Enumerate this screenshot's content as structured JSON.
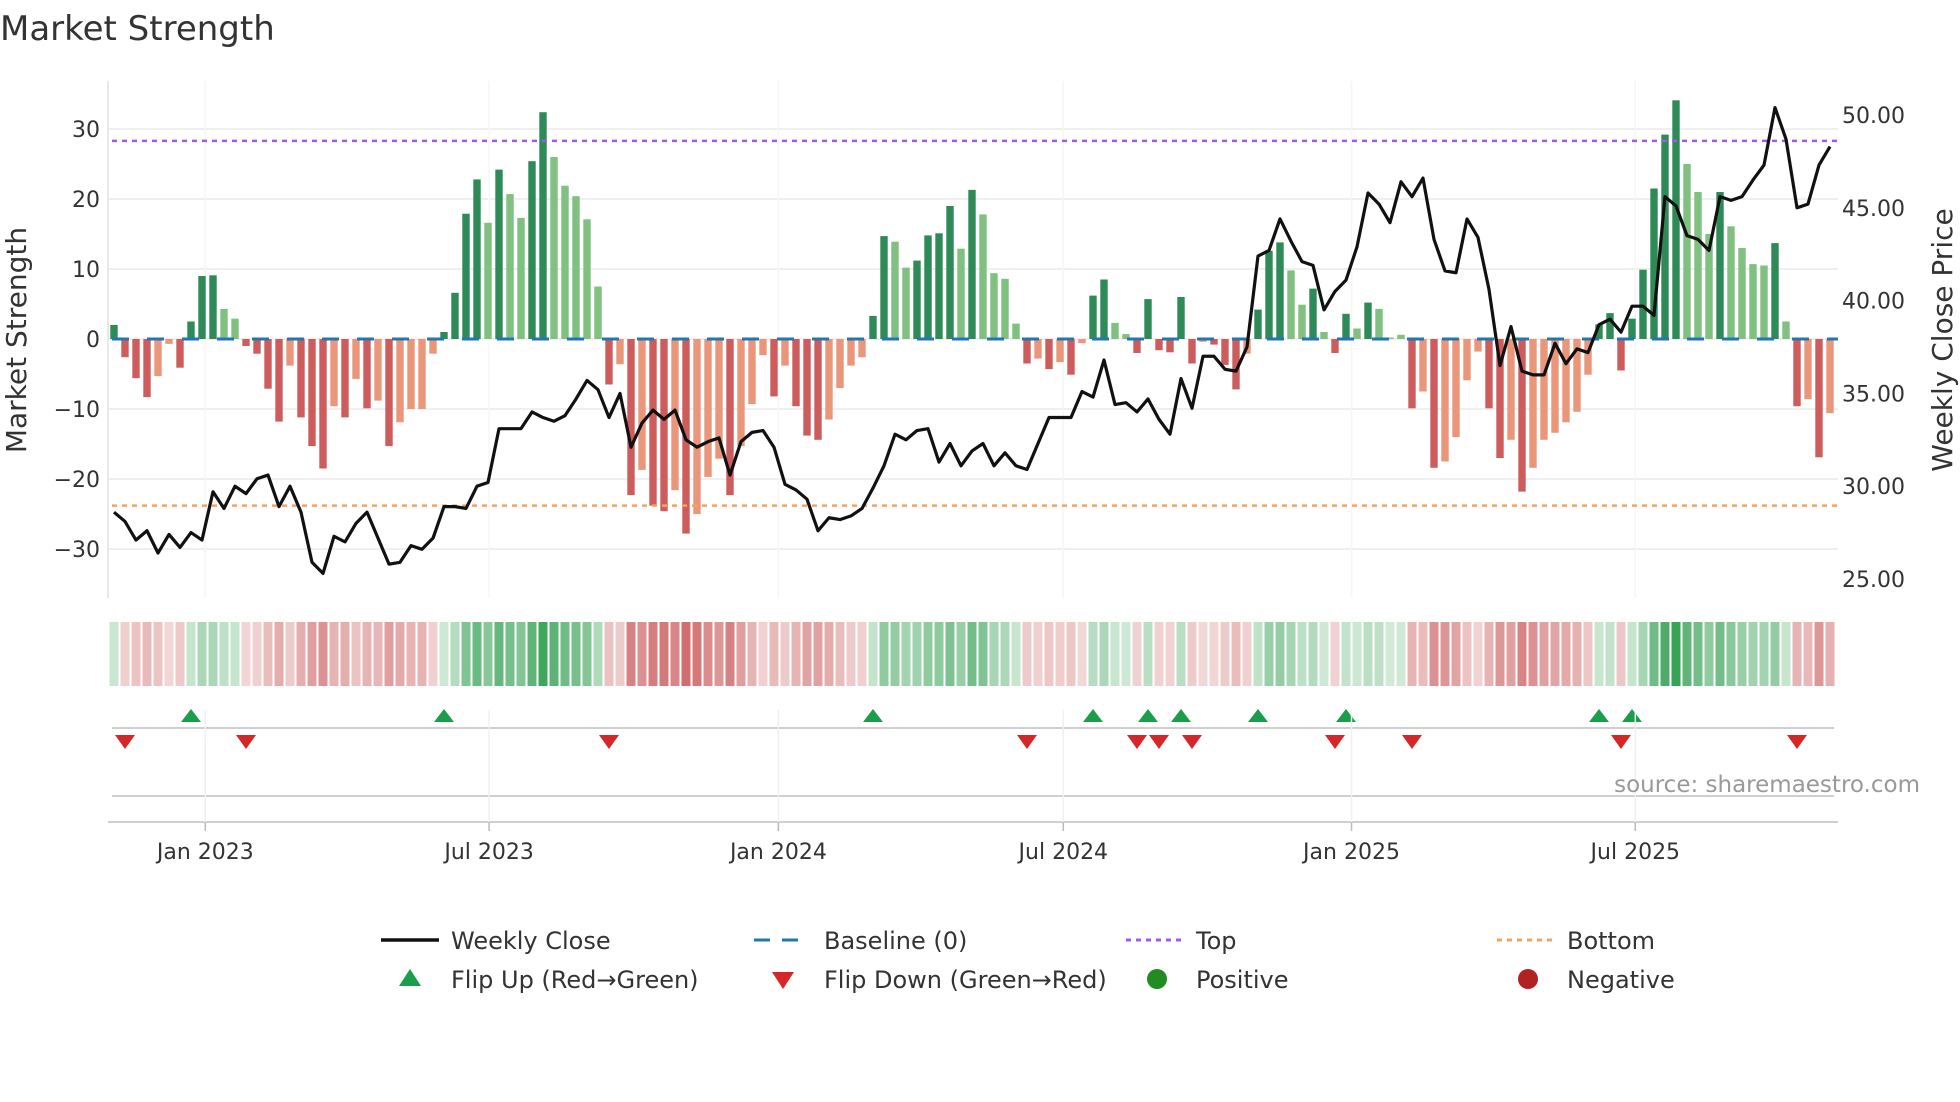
{
  "title": "Market Strength",
  "source": "source: sharemaestro.com",
  "colors": {
    "pos_dark": "#2e8b57",
    "pos_light": "#80c080",
    "neg_dark": "#cd5c5c",
    "neg_light": "#e9967a",
    "baseline": "#1f77b4",
    "top": "#9b5de5",
    "bottom": "#f4a460",
    "flip_up": "#1a9e4a",
    "flip_down": "#d62728",
    "positive": "#228b22",
    "negative": "#b22222",
    "close": "#111111"
  },
  "legend": [
    {
      "label": "Weekly Close",
      "symbol": "line"
    },
    {
      "label": "Baseline (0)",
      "symbol": "dash"
    },
    {
      "label": "Top",
      "symbol": "dot-purple"
    },
    {
      "label": "Bottom",
      "symbol": "dot-orange"
    },
    {
      "label": "Flip Up (Red→Green)",
      "symbol": "triangle-up"
    },
    {
      "label": "Flip Down (Green→Red)",
      "symbol": "triangle-down"
    },
    {
      "label": "Positive",
      "symbol": "circle-green"
    },
    {
      "label": "Negative",
      "symbol": "circle-red"
    }
  ],
  "chart_data": {
    "type": "bar",
    "title": "Market Strength",
    "ylabel": "Market Strength",
    "y2label": "Weekly Close Price",
    "ylim": [
      -37,
      37
    ],
    "y2lim": [
      23.9,
      51.8
    ],
    "yticks": [
      "30",
      "20",
      "10",
      "0",
      "−10",
      "−20",
      "−30"
    ],
    "ytick_values": [
      30,
      20,
      10,
      0,
      -10,
      -20,
      -30
    ],
    "y2ticks": [
      "50.00",
      "45.00",
      "40.00",
      "35.00",
      "30.00",
      "25.00"
    ],
    "y2tick_values": [
      50,
      45,
      40,
      35,
      30,
      25
    ],
    "xticks": [
      {
        "label": "Jan 2023",
        "week": 8.3
      },
      {
        "label": "Jul 2023",
        "week": 34.1
      },
      {
        "label": "Jan 2024",
        "week": 60.4
      },
      {
        "label": "Jul 2024",
        "week": 86.3
      },
      {
        "label": "Jan 2025",
        "week": 112.5
      },
      {
        "label": "Jul 2025",
        "week": 138.3
      }
    ],
    "top_level": 28.3,
    "bottom_level": -23.8,
    "baseline": 0,
    "strength": [
      2.0,
      -2.6,
      -5.6,
      -8.3,
      -5.3,
      -0.7,
      -4.1,
      2.5,
      9.0,
      9.1,
      4.3,
      2.9,
      -1.0,
      -2.1,
      -7.1,
      -11.8,
      -3.8,
      -11.2,
      -15.3,
      -18.5,
      -9.6,
      -11.2,
      -5.7,
      -9.9,
      -8.8,
      -15.3,
      -11.9,
      -10.0,
      -10.0,
      -2.1,
      1.0,
      6.6,
      17.9,
      22.8,
      16.6,
      24.2,
      20.7,
      17.3,
      25.4,
      32.4,
      26.0,
      21.9,
      20.4,
      17.1,
      7.5,
      -6.5,
      -3.6,
      -22.3,
      -18.7,
      -23.8,
      -24.6,
      -21.6,
      -27.8,
      -25.0,
      -19.7,
      -17.1,
      -22.3,
      -15.3,
      -9.3,
      -2.3,
      -8.2,
      -3.8,
      -9.6,
      -13.8,
      -14.4,
      -11.5,
      -7.0,
      -3.8,
      -2.6,
      3.3,
      14.7,
      13.9,
      10.2,
      11.2,
      14.8,
      15.1,
      19.0,
      12.9,
      21.3,
      17.8,
      9.4,
      8.6,
      2.2,
      -3.5,
      -2.8,
      -4.3,
      -3.3,
      -5.1,
      -0.6,
      6.2,
      8.5,
      2.3,
      0.7,
      -2.0,
      5.7,
      -1.6,
      -1.9,
      6.0,
      -3.5,
      -0.4,
      -0.8,
      -3.7,
      -7.2,
      -2.1,
      4.2,
      12.6,
      13.8,
      9.8,
      4.9,
      7.2,
      1.0,
      -2.0,
      3.6,
      1.5,
      5.2,
      4.3,
      0.2,
      0.6,
      -9.9,
      -7.5,
      -18.4,
      -17.5,
      -14.0,
      -5.9,
      -1.8,
      -9.9,
      -17.0,
      -14.4,
      -21.8,
      -18.4,
      -14.4,
      -13.4,
      -11.9,
      -10.4,
      -5.1,
      2.1,
      3.7,
      -4.5,
      2.9,
      9.9,
      21.5,
      29.2,
      34.1,
      25.0,
      21.0,
      15.0,
      21.0,
      16.1,
      13.0,
      10.7,
      10.5,
      13.7,
      2.5,
      -9.6,
      -8.6,
      -16.9,
      -10.6
    ],
    "shade": "DDDDLLDDDDLLDDDDLDDDLDLDLDLLLLDDDDLDLLDDLLLLLDLDLDDLDLLLDLLLDLDDDLLLLDDLLDDDDLDLLLLDLDLDLDDLLDDDDDDLDDDLDDDLLDLDDLDLLLDLDLLLLDDLDLLLLLLDDDDDDDDLLLDLLLLDLDLDL",
    "weekly_close": [
      28.6,
      28.1,
      27.1,
      27.6,
      26.4,
      27.4,
      26.7,
      27.5,
      27.1,
      29.7,
      28.8,
      30.0,
      29.6,
      30.4,
      30.6,
      28.9,
      30.0,
      28.6,
      25.9,
      25.3,
      27.3,
      27.0,
      28.0,
      28.6,
      27.2,
      25.8,
      25.9,
      26.8,
      26.6,
      27.2,
      28.9,
      28.9,
      28.8,
      30.0,
      30.2,
      33.1,
      33.1,
      33.1,
      34.0,
      33.7,
      33.5,
      33.8,
      34.7,
      35.7,
      35.2,
      33.7,
      35.0,
      32.1,
      33.4,
      34.1,
      33.6,
      34.1,
      32.5,
      32.1,
      32.4,
      32.6,
      30.6,
      32.4,
      32.9,
      33.0,
      32.1,
      30.1,
      29.8,
      29.3,
      27.6,
      28.3,
      28.2,
      28.4,
      28.8,
      29.9,
      31.1,
      32.8,
      32.5,
      33.0,
      33.1,
      31.3,
      32.3,
      31.1,
      31.9,
      32.3,
      31.1,
      31.8,
      31.1,
      30.9,
      32.3,
      33.7,
      33.7,
      33.7,
      35.1,
      34.8,
      36.8,
      34.4,
      34.5,
      34.0,
      34.7,
      33.6,
      32.8,
      35.8,
      34.2,
      37.0,
      37.0,
      36.3,
      36.2,
      37.5,
      42.4,
      42.7,
      44.4,
      43.2,
      42.1,
      41.9,
      39.5,
      40.5,
      41.1,
      42.9,
      45.8,
      45.2,
      44.2,
      46.4,
      45.6,
      46.6,
      43.3,
      41.6,
      41.5,
      44.4,
      43.4,
      40.6,
      36.5,
      38.6,
      36.2,
      36.0,
      36.0,
      37.7,
      36.6,
      37.4,
      37.2,
      38.7,
      39.0,
      38.3,
      39.7,
      39.7,
      39.2,
      45.6,
      45.1,
      43.5,
      43.3,
      42.7,
      45.6,
      45.4,
      45.6,
      46.5,
      47.3,
      50.4,
      48.7,
      45.0,
      45.2,
      47.3,
      48.3
    ],
    "flip_up_weeks": [
      7,
      30,
      69,
      89,
      94,
      97,
      104,
      112,
      135,
      138
    ],
    "flip_down_weeks": [
      1,
      12,
      45,
      83,
      93,
      95,
      98,
      111,
      118,
      137,
      153
    ],
    "legend_position": "bottom-center",
    "grid": true
  }
}
